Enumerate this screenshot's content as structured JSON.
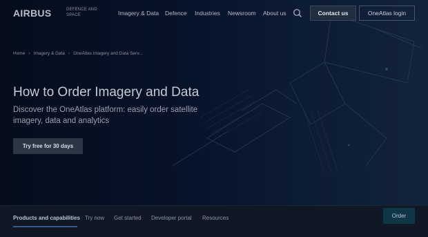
{
  "header": {
    "logo_text": "AIRBUS",
    "logo_subtitle": "DEFENCE AND SPACE",
    "nav_items": [
      "Imagery & Data",
      "Defence",
      "Industries",
      "Newsroom",
      "About us"
    ],
    "contact_label": "Contact us",
    "login_label": "OneAtlas login"
  },
  "breadcrumb": [
    "Home",
    "Imagery & Data",
    "OneAtlas Imagery and Data Serv..."
  ],
  "hero": {
    "title": "How to Order Imagery and Data",
    "subtitle": "Discover the OneAtlas platform: easily order satellite imagery, data and analytics",
    "cta_label": "Try free for 30 days"
  },
  "tabbar": {
    "tabs": [
      "Products and capabilities",
      "Try now",
      "Get started",
      "Developer portal",
      "Resources"
    ],
    "active_tab": "Products and capabilities",
    "order_label": "Order"
  },
  "colors": {
    "background": "#06101f",
    "tab_bar": "#0f1824",
    "order_button": "#0e3646"
  }
}
